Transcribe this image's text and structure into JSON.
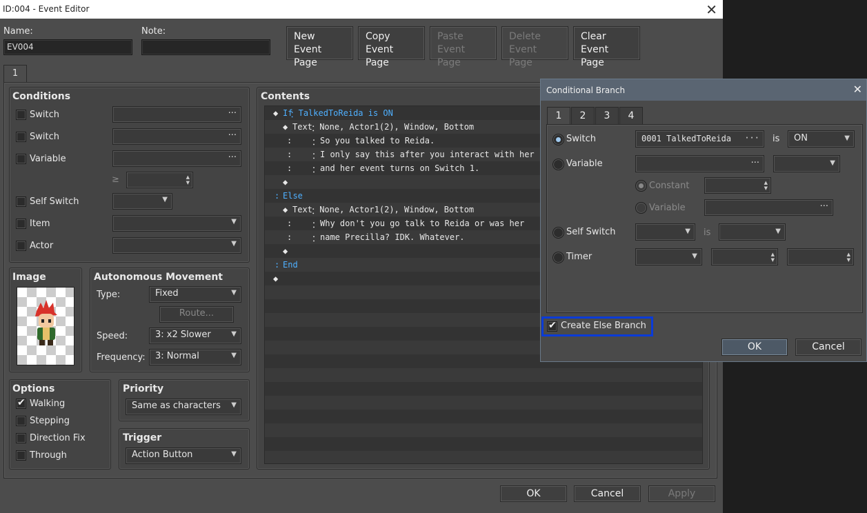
{
  "window": {
    "title": "ID:004 - Event Editor",
    "close": "✕"
  },
  "header": {
    "name_label": "Name:",
    "name_value": "EV004",
    "note_label": "Note:",
    "note_value": "",
    "buttons": {
      "new": [
        "New",
        "Event Page"
      ],
      "copy": [
        "Copy",
        "Event Page"
      ],
      "paste": [
        "Paste",
        "Event Page"
      ],
      "delete": [
        "Delete",
        "Event Page"
      ],
      "clear": [
        "Clear",
        "Event Page"
      ]
    }
  },
  "page_tab": "1",
  "conditions": {
    "title": "Conditions",
    "switch1": "Switch",
    "switch2": "Switch",
    "variable": "Variable",
    "ge": "≥",
    "self_switch": "Self Switch",
    "item": "Item",
    "actor": "Actor",
    "dots": "···"
  },
  "image": {
    "title": "Image"
  },
  "autonomous": {
    "title": "Autonomous Movement",
    "type_label": "Type:",
    "type_value": "Fixed",
    "route": "Route...",
    "speed_label": "Speed:",
    "speed_value": "3: x2 Slower",
    "freq_label": "Frequency:",
    "freq_value": "3: Normal"
  },
  "options": {
    "title": "Options",
    "walking": "Walking",
    "stepping": "Stepping",
    "direction_fix": "Direction Fix",
    "through": "Through",
    "checkmark": "✔"
  },
  "priority": {
    "title": "Priority",
    "value": "Same as characters"
  },
  "trigger": {
    "title": "Trigger",
    "value": "Action Button"
  },
  "contents": {
    "title": "Contents",
    "lines": [
      {
        "marker": "◆",
        "kw": "If",
        "sep": "：",
        "text": "TalkedToReida is ON"
      },
      {
        "marker": "◆",
        "kw": "Text",
        "sep": "：",
        "text": "None, Actor1(2), Window, Bottom"
      },
      {
        "marker": ":",
        "kw": "",
        "sep": "：",
        "text": "So you talked to Reida."
      },
      {
        "marker": ":",
        "kw": "",
        "sep": "：",
        "text": "I only say this after you interact with her"
      },
      {
        "marker": ":",
        "kw": "",
        "sep": "：",
        "text": "and her event turns on Switch 1."
      },
      {
        "marker": "◆",
        "kw": "",
        "sep": "",
        "text": ""
      },
      {
        "marker": ":",
        "kw": "Else",
        "sep": "",
        "text": ""
      },
      {
        "marker": "◆",
        "kw": "Text",
        "sep": "：",
        "text": "None, Actor1(2), Window, Bottom"
      },
      {
        "marker": ":",
        "kw": "",
        "sep": "：",
        "text": "Why don't you go talk to Reida or was her"
      },
      {
        "marker": ":",
        "kw": "",
        "sep": "：",
        "text": "name Precilla? IDK. Whatever."
      },
      {
        "marker": "◆",
        "kw": "",
        "sep": "",
        "text": ""
      },
      {
        "marker": ":",
        "kw": "End",
        "sep": "",
        "text": ""
      },
      {
        "marker": "◆",
        "kw": "",
        "sep": "",
        "text": ""
      }
    ]
  },
  "footer": {
    "ok": "OK",
    "cancel": "Cancel",
    "apply": "Apply"
  },
  "dialog": {
    "title": "Conditional Branch",
    "close": "✕",
    "tabs": [
      "1",
      "2",
      "3",
      "4"
    ],
    "switch_label": "Switch",
    "switch_value": "0001 TalkedToReida",
    "is": "is",
    "switch_state": "ON",
    "variable_label": "Variable",
    "constant_label": "Constant",
    "variable_sub_label": "Variable",
    "self_switch_label": "Self Switch",
    "timer_label": "Timer",
    "else_branch": "Create Else Branch",
    "ok": "OK",
    "cancel": "Cancel"
  }
}
